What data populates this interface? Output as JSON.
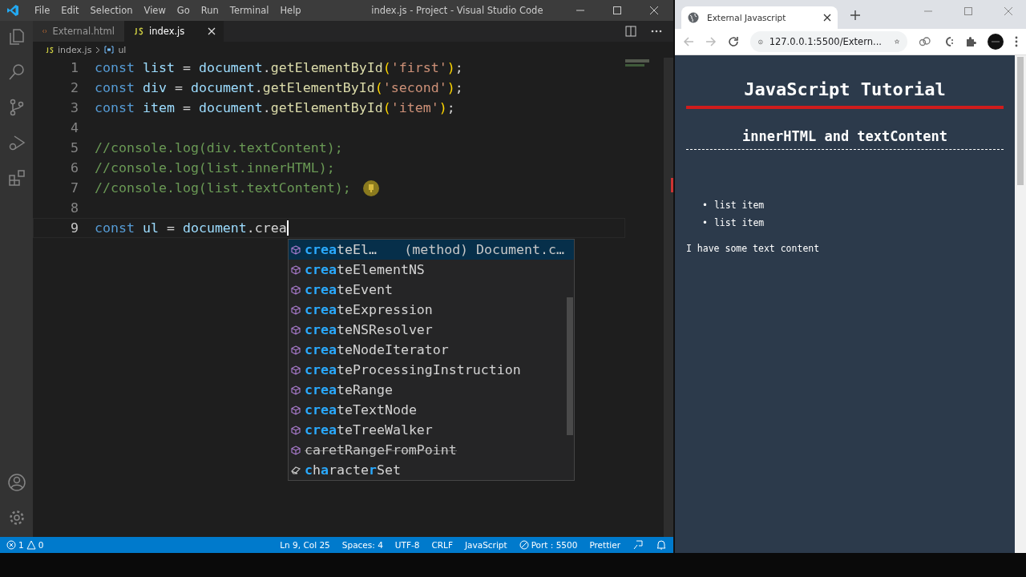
{
  "editor_window": {
    "title": "index.js - Project - Visual Studio Code",
    "menu": [
      "File",
      "Edit",
      "Selection",
      "View",
      "Go",
      "Run",
      "Terminal",
      "Help"
    ],
    "tabs": [
      {
        "label": "External.html",
        "kind": "html",
        "selected": false
      },
      {
        "label": "index.js",
        "kind": "js",
        "selected": true
      }
    ],
    "breadcrumb": [
      "index.js",
      "ul"
    ],
    "lines": [
      {
        "number": "1",
        "current": false,
        "tokens": [
          {
            "kind": "keyword",
            "text": "const "
          },
          {
            "kind": "var",
            "text": "list"
          },
          {
            "kind": "plain",
            "text": " = "
          },
          {
            "kind": "var",
            "text": "document"
          },
          {
            "kind": "plain",
            "text": "."
          },
          {
            "kind": "func",
            "text": "getElementById"
          },
          {
            "kind": "paren",
            "text": "("
          },
          {
            "kind": "string",
            "text": "'first'"
          },
          {
            "kind": "paren",
            "text": ")"
          },
          {
            "kind": "plain",
            "text": ";"
          }
        ]
      },
      {
        "number": "2",
        "current": false,
        "tokens": [
          {
            "kind": "keyword",
            "text": "const "
          },
          {
            "kind": "var",
            "text": "div"
          },
          {
            "kind": "plain",
            "text": " = "
          },
          {
            "kind": "var",
            "text": "document"
          },
          {
            "kind": "plain",
            "text": "."
          },
          {
            "kind": "func",
            "text": "getElementById"
          },
          {
            "kind": "paren",
            "text": "("
          },
          {
            "kind": "string",
            "text": "'second'"
          },
          {
            "kind": "paren",
            "text": ")"
          },
          {
            "kind": "plain",
            "text": ";"
          }
        ]
      },
      {
        "number": "3",
        "current": false,
        "tokens": [
          {
            "kind": "keyword",
            "text": "const "
          },
          {
            "kind": "var",
            "text": "item"
          },
          {
            "kind": "plain",
            "text": " = "
          },
          {
            "kind": "var",
            "text": "document"
          },
          {
            "kind": "plain",
            "text": "."
          },
          {
            "kind": "func",
            "text": "getElementById"
          },
          {
            "kind": "paren",
            "text": "("
          },
          {
            "kind": "string",
            "text": "'item'"
          },
          {
            "kind": "paren",
            "text": ")"
          },
          {
            "kind": "plain",
            "text": ";"
          }
        ]
      },
      {
        "number": "4",
        "current": false
      },
      {
        "number": "5",
        "current": false,
        "tokens": [
          {
            "kind": "comment",
            "text": "//console.log(div.textContent);"
          }
        ]
      },
      {
        "number": "6",
        "current": false,
        "tokens": [
          {
            "kind": "comment",
            "text": "//console.log(list.innerHTML);"
          }
        ]
      },
      {
        "number": "7",
        "current": false,
        "lightbulb": true,
        "tokens": [
          {
            "kind": "comment",
            "text": "//console.log(list.textContent);"
          }
        ]
      },
      {
        "number": "8",
        "current": false
      },
      {
        "number": "9",
        "current": true,
        "tokens": [
          {
            "kind": "keyword",
            "text": "const "
          },
          {
            "kind": "var",
            "text": "ul"
          },
          {
            "kind": "plain",
            "text": " = "
          },
          {
            "kind": "var",
            "text": "document"
          },
          {
            "kind": "plain",
            "text": "."
          },
          {
            "kind": "plain",
            "text": "crea"
          }
        ]
      }
    ],
    "suggestions": [
      {
        "kind": "method",
        "selected": true,
        "deprecated": false,
        "parts": [
          {
            "text": "crea",
            "match": true
          },
          {
            "text": "teEl…",
            "match": false
          }
        ],
        "detail": "(method) Document.c…"
      },
      {
        "kind": "method",
        "selected": false,
        "deprecated": false,
        "parts": [
          {
            "text": "crea",
            "match": true
          },
          {
            "text": "teElementNS",
            "match": false
          }
        ]
      },
      {
        "kind": "method",
        "selected": false,
        "deprecated": false,
        "parts": [
          {
            "text": "crea",
            "match": true
          },
          {
            "text": "teEvent",
            "match": false
          }
        ]
      },
      {
        "kind": "method",
        "selected": false,
        "deprecated": false,
        "parts": [
          {
            "text": "crea",
            "match": true
          },
          {
            "text": "teExpression",
            "match": false
          }
        ]
      },
      {
        "kind": "method",
        "selected": false,
        "deprecated": false,
        "parts": [
          {
            "text": "crea",
            "match": true
          },
          {
            "text": "teNSResolver",
            "match": false
          }
        ]
      },
      {
        "kind": "method",
        "selected": false,
        "deprecated": false,
        "parts": [
          {
            "text": "crea",
            "match": true
          },
          {
            "text": "teNodeIterator",
            "match": false
          }
        ]
      },
      {
        "kind": "method",
        "selected": false,
        "deprecated": false,
        "parts": [
          {
            "text": "crea",
            "match": true
          },
          {
            "text": "teProcessingInstruction",
            "match": false
          }
        ]
      },
      {
        "kind": "method",
        "selected": false,
        "deprecated": false,
        "parts": [
          {
            "text": "crea",
            "match": true
          },
          {
            "text": "teRange",
            "match": false
          }
        ]
      },
      {
        "kind": "method",
        "selected": false,
        "deprecated": false,
        "parts": [
          {
            "text": "crea",
            "match": true
          },
          {
            "text": "teTextNode",
            "match": false
          }
        ]
      },
      {
        "kind": "method",
        "selected": false,
        "deprecated": false,
        "parts": [
          {
            "text": "crea",
            "match": true
          },
          {
            "text": "teTreeWalker",
            "match": false
          }
        ]
      },
      {
        "kind": "method",
        "selected": false,
        "deprecated": true,
        "parts": [
          {
            "text": "caretRangeFromPoint",
            "match": false
          }
        ]
      },
      {
        "kind": "property",
        "selected": false,
        "deprecated": false,
        "parts": [
          {
            "text": "c",
            "match": true
          },
          {
            "text": "h",
            "match": false
          },
          {
            "text": "a",
            "match": true
          },
          {
            "text": "racte",
            "match": false
          },
          {
            "text": "r",
            "match": true
          },
          {
            "text": "Set",
            "match": false
          }
        ]
      }
    ],
    "status_bar": {
      "errors": "1",
      "warnings": "0",
      "items": [
        "Ln 9, Col 25",
        "Spaces: 4",
        "UTF-8",
        "CRLF",
        "JavaScript",
        "Port : 5500",
        "Prettier"
      ]
    }
  },
  "browser_window": {
    "tab_title": "External Javascript",
    "address": "127.0.0.1:5500/Extern...",
    "page": {
      "heading": "JavaScript Tutorial",
      "subheading": "innerHTML and textContent",
      "list_items": [
        {
          "bullet": "•",
          "text": "list item"
        },
        {
          "bullet": "•",
          "text": "list item"
        }
      ],
      "paragraph": "I have some text content"
    }
  }
}
